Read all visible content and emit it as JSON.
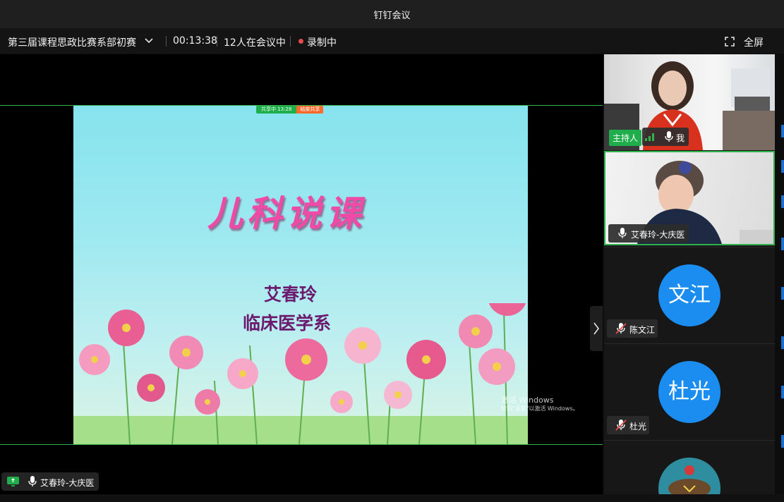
{
  "window": {
    "title": "钉钉会议"
  },
  "meeting": {
    "title": "第三届课程思政比赛系部初赛",
    "elapsed": "00:13:38",
    "participants": "12人在会议中",
    "recording": "录制中",
    "fullscreen": "全屏"
  },
  "share": {
    "status_text": "共享中 13:28",
    "stop_text": "结束共享",
    "slide": {
      "title": "儿科说课",
      "presenter": "艾春玲",
      "department": "临床医学系"
    },
    "watermark": [
      "激活 Windows",
      "转到\"设置\"以激活 Windows。"
    ],
    "presenter_tag": "艾春玲-大庆医"
  },
  "participants": [
    {
      "name": "我",
      "role": "主持人",
      "video": true
    },
    {
      "name": "艾春玲-大庆医",
      "video": true,
      "speaking": true
    },
    {
      "name": "陈文江",
      "avatar_text": "文江",
      "muted": true,
      "avatar_color": "#1b8cf0"
    },
    {
      "name": "杜光",
      "avatar_text": "杜光",
      "muted": true,
      "avatar_color": "#1b8cf0"
    }
  ],
  "colors": {
    "accent_green": "#2fb24c",
    "record_red": "#e84d4d",
    "avatar_blue": "#1b8cf0",
    "slide_title_pink": "#f04aa8"
  }
}
